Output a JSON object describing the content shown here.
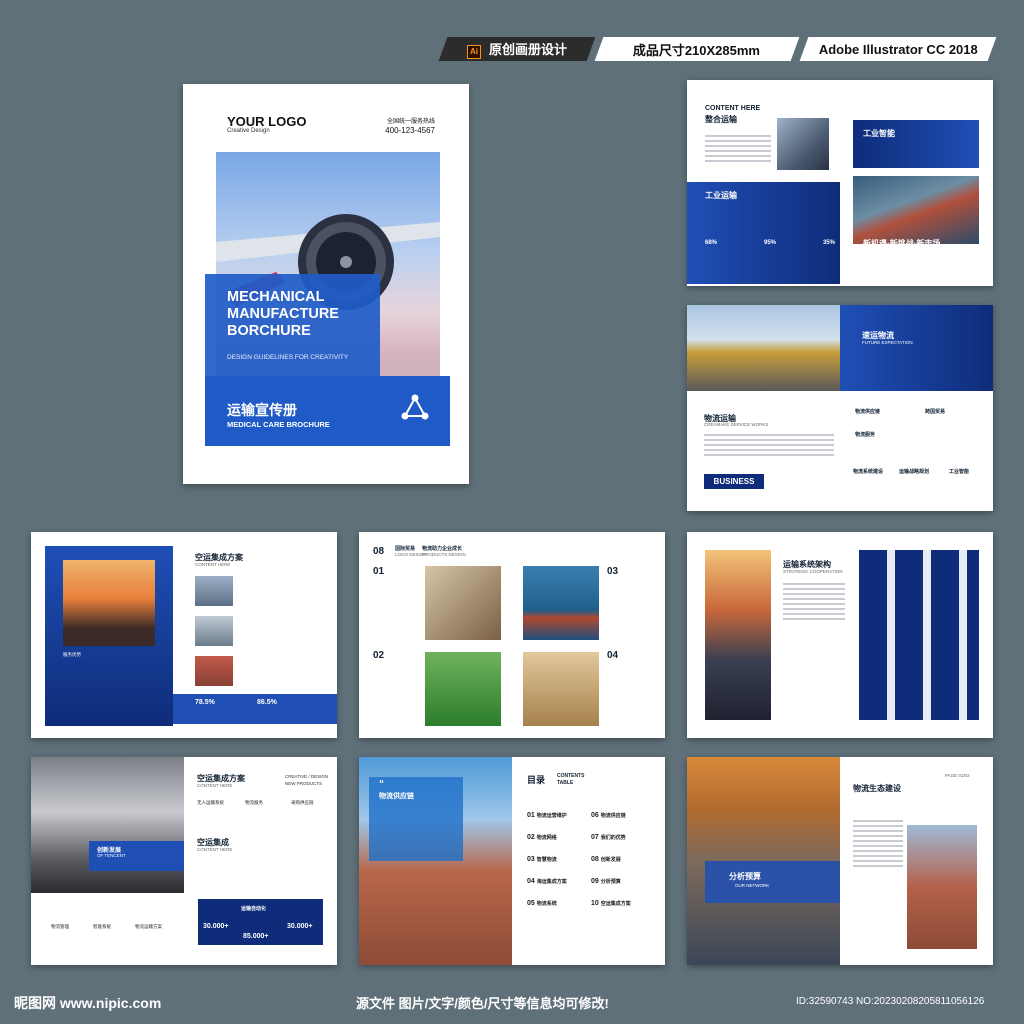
{
  "badges": {
    "ai_icon": "Ai",
    "design": "原创画册设计",
    "size": "成品尺寸210X285mm",
    "software": "Adobe Illustrator CC 2018"
  },
  "cover": {
    "logo": "YOUR LOGO",
    "logo_sub": "Creative Design",
    "hotline_label": "全国统一服务热线",
    "phone": "400-123-4567",
    "title": "MECHANICAL\nMANUFACTURE\nBORCHURE",
    "guide": "DESIGN GUIDELINES FOR CREATIVITY",
    "cn_title": "运输宣传册",
    "subtitle": "MEDICAL CARE BROCHURE"
  },
  "spread1": {
    "content_here": "CONTENT HERE",
    "cn_heading": "整合运输",
    "box_heading": "工业运输",
    "stats": [
      "68%",
      "95%",
      "35%"
    ],
    "right_heading": "工业智能",
    "banner": "新机遇·新挑战·新市场",
    "banner_sub": "NEW OPPORTUNITIES, NEW CHALLENGE AND NEW MARKETS"
  },
  "spread2": {
    "heading": "速运物流",
    "heading_en": "FUTURE EXPECTATION",
    "left_heading": "物流运输",
    "left_heading_en": "CREAMAKE SERVICE WORKS",
    "business": "BUSINESS",
    "items": [
      "物流供应链",
      "跨国贸易",
      "物流服务",
      "",
      "物流系统建设",
      "运输战略规划",
      "工业智能"
    ]
  },
  "spread3": {
    "heading": "空运集成方案",
    "heading_en": "CONTENT HERE",
    "left_caption": "服务优势",
    "stats": [
      "78.5%",
      "86.5%"
    ]
  },
  "spread4": {
    "num": "08",
    "heading": "国际贸易",
    "heading_en": "LOGO DESIGN",
    "right_heading": "物流助力企业成长",
    "right_heading_en": "PRODUCTS DESIGN",
    "numbers": [
      "01",
      "02",
      "03",
      "04"
    ]
  },
  "spread5": {
    "heading": "运输系统架构",
    "heading_en": "STRATEGIC COOPERATION"
  },
  "spread6": {
    "left_caption": "创新发展",
    "left_caption_en": "OF TENCENT",
    "heading": "空运集成方案",
    "heading_en": "CONTENT HERE",
    "creative": "CREATIVE / DESIGN",
    "creative_sub": "NEW PRODUCTS",
    "heading2": "空运集成",
    "heading2_en": "CONTENT HERE",
    "labels": [
      "无人运输系统",
      "物流服务",
      "采购供应链"
    ],
    "box_title": "运输自动化",
    "nums": [
      "30.000+",
      "85.000+",
      "30.000+"
    ],
    "bottom_labels": [
      "物流管理",
      "智能系统",
      "物流运输方案"
    ]
  },
  "spread7": {
    "quote": "“",
    "heading": "物流供应链",
    "toc": "目录",
    "toc_en": "CONTENTS",
    "toc_en2": "TABLE",
    "entries_left": [
      {
        "num": "01",
        "label": "物流运营维护"
      },
      {
        "num": "02",
        "label": "物流网络"
      },
      {
        "num": "03",
        "label": "智慧物流"
      },
      {
        "num": "04",
        "label": "海运集成方案"
      },
      {
        "num": "05",
        "label": "物流系统"
      }
    ],
    "entries_right": [
      {
        "num": "06",
        "label": "物流供应链"
      },
      {
        "num": "07",
        "label": "我们的优势"
      },
      {
        "num": "08",
        "label": "创新发展"
      },
      {
        "num": "09",
        "label": "分析预算"
      },
      {
        "num": "10",
        "label": "空运集成方案"
      }
    ]
  },
  "spread8": {
    "box_title": "分析预算",
    "box_sub": "OUR NETWORK",
    "heading": "物流生态建设",
    "page": "PAGE 01/02"
  },
  "footer": {
    "brand": "昵图网 www.nipic.com",
    "note": "源文件 图片/文字/颜色/尺寸等信息均可修改!",
    "id": "ID:32590743 NO:20230208205811056126"
  },
  "colors": {
    "background": "#5f7079",
    "accent_blue": "#1f4fb5",
    "dark_blue": "#0f2c7a"
  }
}
